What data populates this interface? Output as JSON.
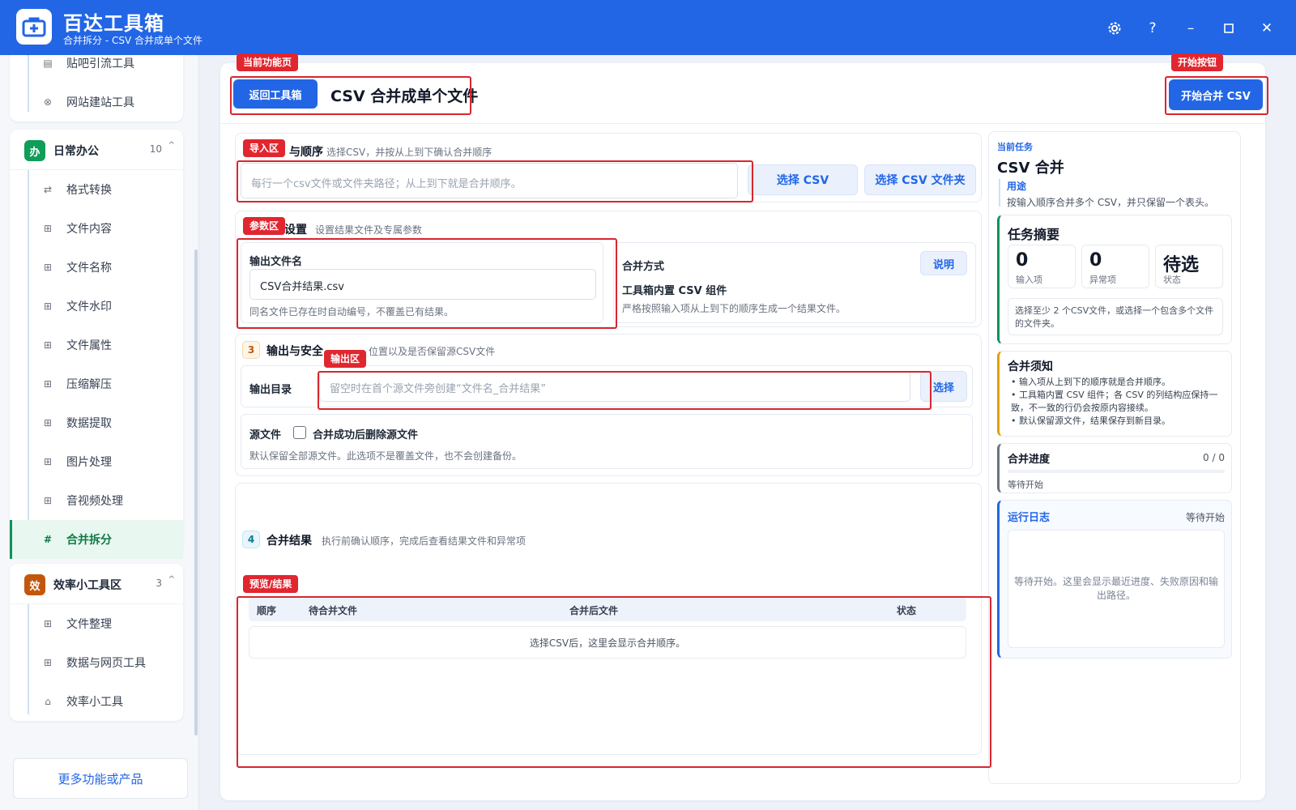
{
  "app": {
    "title": "百达工具箱",
    "subtitle": "合并拆分 - CSV 合并成单个文件",
    "window_controls": [
      "gear-icon",
      "help-icon",
      "minimize-icon",
      "maximize-icon",
      "close-icon"
    ]
  },
  "sidebar": {
    "prev_items": [
      {
        "label": "贴吧引流工具",
        "icon": "document-icon"
      },
      {
        "label": "网站建站工具",
        "icon": "globe-icon"
      }
    ],
    "group_office": {
      "badge": "办",
      "title": "日常办公",
      "count": "10",
      "color": "#0f9d58",
      "items": [
        {
          "label": "格式转换",
          "icon": "swap-icon"
        },
        {
          "label": "文件内容",
          "icon": "grid-icon"
        },
        {
          "label": "文件名称",
          "icon": "grid-icon"
        },
        {
          "label": "文件水印",
          "icon": "grid-icon"
        },
        {
          "label": "文件属性",
          "icon": "grid-icon"
        },
        {
          "label": "压缩解压",
          "icon": "grid-icon"
        },
        {
          "label": "数据提取",
          "icon": "grid-icon"
        },
        {
          "label": "图片处理",
          "icon": "grid-icon"
        },
        {
          "label": "音视频处理",
          "icon": "grid-icon"
        },
        {
          "label": "合并拆分",
          "icon": "hash-icon",
          "active": true
        }
      ]
    },
    "group_efficiency": {
      "badge": "效",
      "title": "效率小工具区",
      "count": "3",
      "color": "#c2570c",
      "items": [
        {
          "label": "文件整理",
          "icon": "grid-icon"
        },
        {
          "label": "数据与网页工具",
          "icon": "grid-icon"
        },
        {
          "label": "效率小工具",
          "icon": "box-icon"
        }
      ]
    },
    "more_label": "更多功能或产品"
  },
  "header": {
    "back_label": "返回工具箱",
    "page_title": "CSV 合并成单个文件",
    "start_label": "开始合并 CSV"
  },
  "import": {
    "title": "与顺序",
    "desc": "选择CSV，并按从上到下确认合并顺序",
    "placeholder": "每行一个csv文件或文件夹路径；从上到下就是合并顺序。",
    "select_csv": "选择 CSV",
    "select_folder": "选择 CSV 文件夹"
  },
  "params": {
    "title": "设置",
    "desc": "设置结果文件及专属参数",
    "filename_label": "输出文件名",
    "filename_value": "CSV合并结果.csv",
    "filename_hint": "同名文件已存在时自动编号，不覆盖已有结果。",
    "method_label": "合并方式",
    "method_help": "说明",
    "method_value": "工具箱内置 CSV 组件",
    "method_hint": "严格按照输入项从上到下的顺序生成一个结果文件。"
  },
  "output": {
    "num": "3",
    "title": "输出与安全",
    "desc": "位置以及是否保留源CSV文件",
    "dir_label": "输出目录",
    "dir_placeholder": "留空时在首个源文件旁创建“文件名_合并结果”",
    "dir_button": "选择",
    "source_label": "源文件",
    "delete_label": "合并成功后删除源文件",
    "source_hint": "默认保留全部源文件。此选项不是覆盖文件，也不会创建备份。"
  },
  "result": {
    "num": "4",
    "title": "合并结果",
    "desc": "执行前确认顺序，完成后查看结果文件和异常项",
    "columns": [
      "顺序",
      "待合并文件",
      "合并后文件",
      "状态"
    ],
    "empty": "选择CSV后，这里会显示合并顺序。"
  },
  "task": {
    "kicker": "当前任务",
    "title": "CSV 合并",
    "purpose_label": "用途",
    "purpose_text": "按输入顺序合并多个 CSV，并只保留一个表头。",
    "summary_title": "任务摘要",
    "stats": [
      {
        "value": "0",
        "label": "输入项"
      },
      {
        "value": "0",
        "label": "异常项"
      },
      {
        "value": "待选",
        "label": "状态"
      }
    ],
    "summary_hint": "选择至少 2 个CSV文件，或选择一个包含多个文件的文件夹。",
    "notice_title": "合并须知",
    "notices": [
      "输入项从上到下的顺序就是合并顺序。",
      "工具箱内置 CSV 组件；各 CSV 的列结构应保持一致，不一致的行仍会按原内容接续。",
      "默认保留源文件，结果保存到新目录。"
    ],
    "progress_title": "合并进度",
    "progress_count": "0 / 0",
    "progress_value": 0,
    "progress_status": "等待开始",
    "log_title": "运行日志",
    "log_status": "等待开始",
    "log_placeholder": "等待开始。这里会显示最近进度、失败原因和输出路径。"
  },
  "annotations": [
    "当前功能页",
    "开始按钮",
    "导入区",
    "参数区",
    "输出区",
    "预览/结果"
  ],
  "colors": {
    "brand": "#2266e6",
    "annotation": "#e0262f",
    "active_green": "#0f7a44"
  }
}
